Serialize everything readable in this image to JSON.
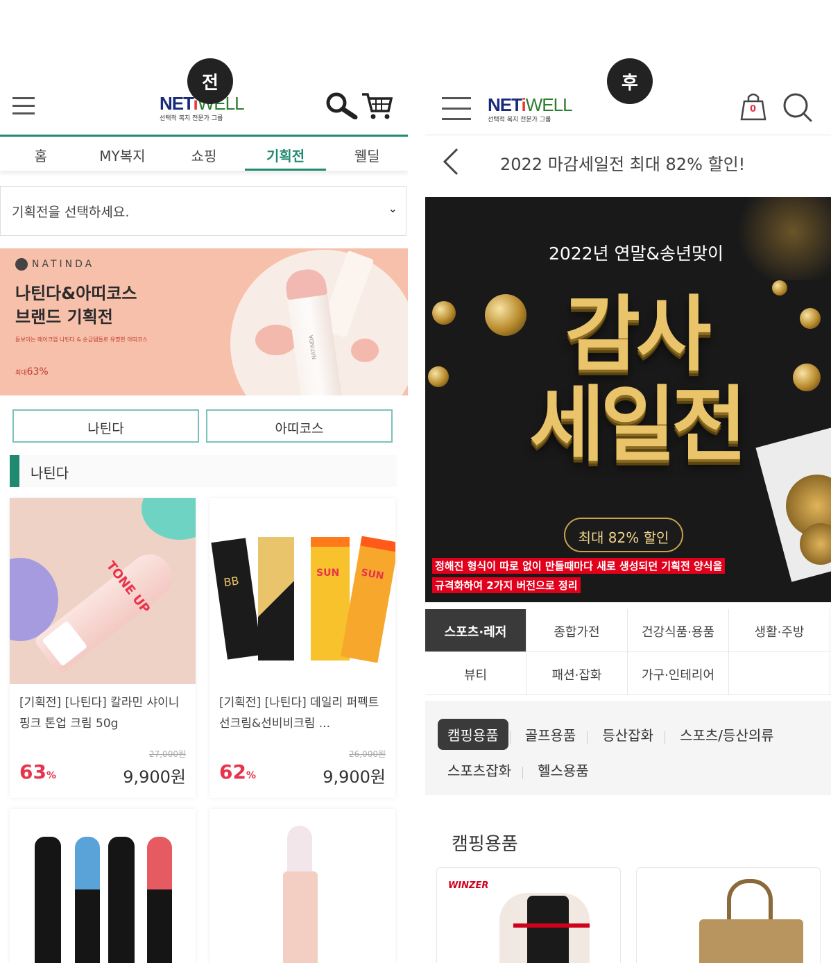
{
  "before": {
    "badge": "전",
    "logo": {
      "net": "NET",
      "i": "i",
      "well": "WELL",
      "tagline": "선택적 복지 전문가 그룹"
    },
    "nav_tabs": [
      "홈",
      "MY복지",
      "쇼핑",
      "기획전",
      "웰딜"
    ],
    "active_tab": "기획전",
    "select_placeholder": "기획전을 선택하세요.",
    "banner": {
      "brand": "NATINDA",
      "title": "나틴다&아띠코스\n브랜드 기획전",
      "subtitle": "돋보이는 메이크업 나틴다 & 순금템들로 유명한 아띠코스",
      "discount_prefix": "최대",
      "discount": "63%",
      "product_text": "NATINDA"
    },
    "brand_buttons": [
      "나틴다",
      "아띠코스"
    ],
    "section_title": "나틴다",
    "products": [
      {
        "name": "[기획전] [나틴다] 칼라민 샤이니 핑크 톤업 크림 50g",
        "original_price": "27,000원",
        "discount_rate": "63",
        "price": "9,900원",
        "label": "TONE UP"
      },
      {
        "name": "[기획전] [나틴다] 데일리 퍼펙트 선크림&선비비크림 ...",
        "original_price": "26,000원",
        "discount_rate": "62",
        "price": "9,900원",
        "label_bb": "BB",
        "label_sun": "SUN"
      }
    ],
    "percent_sign": "%"
  },
  "after": {
    "badge": "후",
    "logo": {
      "net": "NET",
      "i": "i",
      "well": "WELL",
      "tagline": "선택적 복지 전문가 그룹"
    },
    "cart_count": "0",
    "page_title": "2022 마감세일전 최대 82% 할인!",
    "hero": {
      "subtitle": "2022년 연말&송년맞이",
      "line1": "감사",
      "line2": "세일전",
      "pill": "최대 82% 할인"
    },
    "annotation": [
      "정해진 형식이 따로 없이 만들때마다 새로 생성되던 기획전 양식을",
      "규격화하여 2가지 버전으로 정리"
    ],
    "categories": [
      [
        "스포츠·레저",
        "종합가전",
        "건강식품·용품",
        "생활·주방"
      ],
      [
        "뷰티",
        "패션·잡화",
        "가구·인테리어",
        ""
      ]
    ],
    "active_category": "스포츠·레저",
    "subcategories": [
      "캠핑용품",
      "골프용품",
      "등산잡화",
      "스포츠/등산의류",
      "스포츠잡화",
      "헬스용품"
    ],
    "active_subcategory": "캠핑용품",
    "section_title": "캠핑용품",
    "card_brand": "WINZER"
  },
  "colors": {
    "accent": "#1f8a70",
    "sale": "#e8334a",
    "gold": "#e9c46a",
    "annotation": "#e0001b"
  }
}
